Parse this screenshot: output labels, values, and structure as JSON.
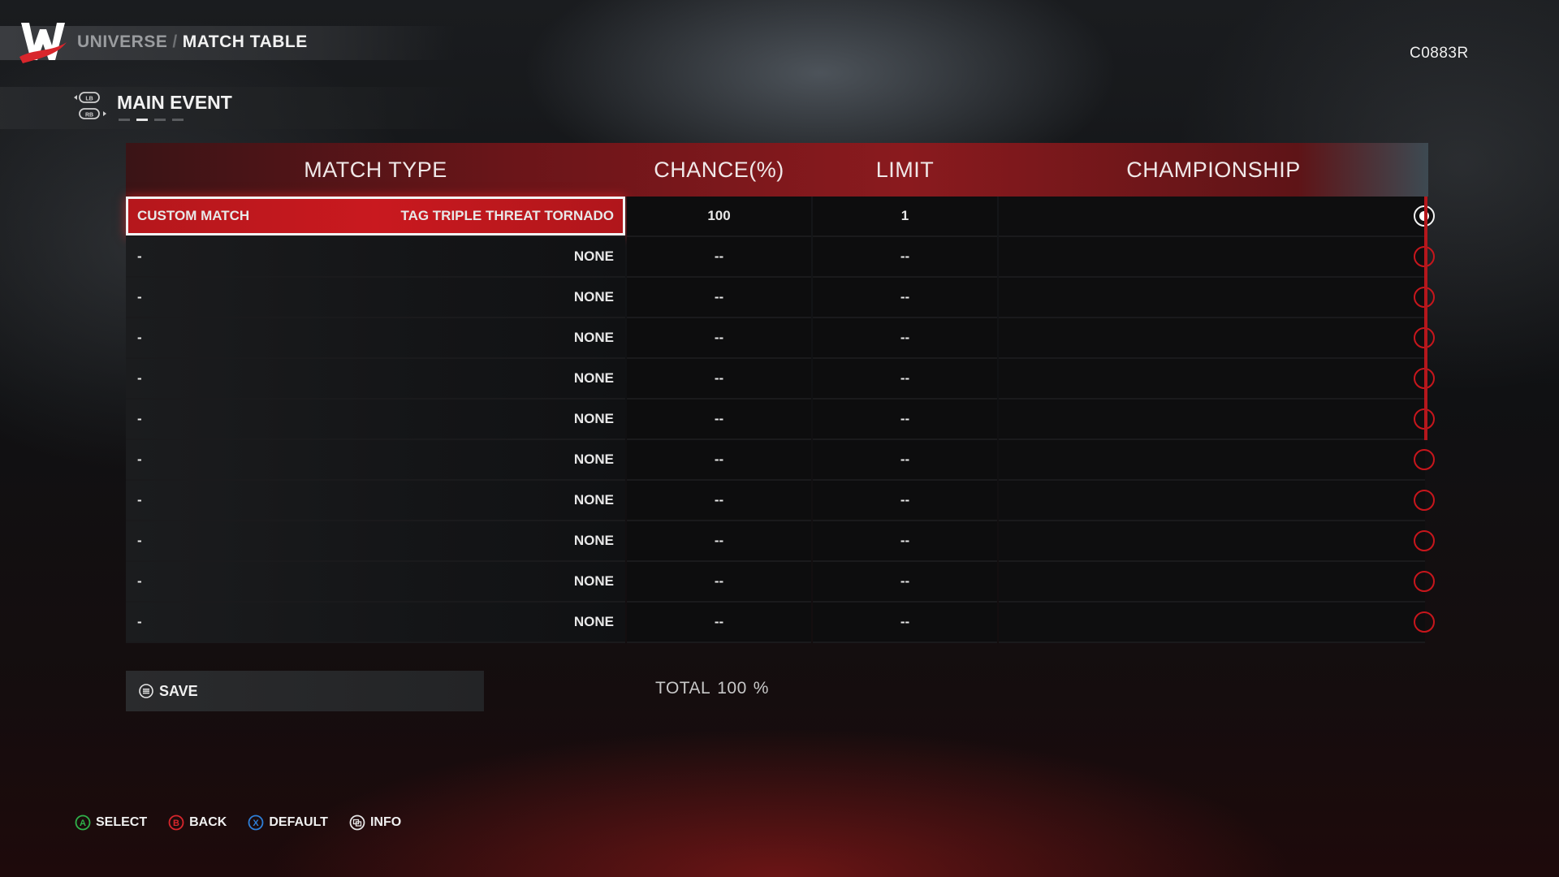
{
  "header": {
    "breadcrumb_parent": "UNIVERSE",
    "breadcrumb_separator": "/",
    "breadcrumb_current": "MATCH TABLE",
    "user_code": "C0883R"
  },
  "section": {
    "title": "MAIN EVENT",
    "page_count": 4,
    "current_page": 2,
    "prev_button": "LB",
    "next_button": "RB"
  },
  "table": {
    "columns": {
      "match_type": "MATCH TYPE",
      "chance": "CHANCE(%)",
      "limit": "LIMIT",
      "championship": "CHAMPIONSHIP"
    },
    "rows": [
      {
        "category": "CUSTOM MATCH",
        "match": "TAG TRIPLE THREAT TORNADO",
        "chance": "100",
        "limit": "1",
        "championship": true,
        "selected": true
      },
      {
        "category": "-",
        "match": "NONE",
        "chance": "--",
        "limit": "--",
        "championship": false,
        "selected": false
      },
      {
        "category": "-",
        "match": "NONE",
        "chance": "--",
        "limit": "--",
        "championship": false,
        "selected": false
      },
      {
        "category": "-",
        "match": "NONE",
        "chance": "--",
        "limit": "--",
        "championship": false,
        "selected": false
      },
      {
        "category": "-",
        "match": "NONE",
        "chance": "--",
        "limit": "--",
        "championship": false,
        "selected": false
      },
      {
        "category": "-",
        "match": "NONE",
        "chance": "--",
        "limit": "--",
        "championship": false,
        "selected": false
      },
      {
        "category": "-",
        "match": "NONE",
        "chance": "--",
        "limit": "--",
        "championship": false,
        "selected": false
      },
      {
        "category": "-",
        "match": "NONE",
        "chance": "--",
        "limit": "--",
        "championship": false,
        "selected": false
      },
      {
        "category": "-",
        "match": "NONE",
        "chance": "--",
        "limit": "--",
        "championship": false,
        "selected": false
      },
      {
        "category": "-",
        "match": "NONE",
        "chance": "--",
        "limit": "--",
        "championship": false,
        "selected": false
      },
      {
        "category": "-",
        "match": "NONE",
        "chance": "--",
        "limit": "--",
        "championship": false,
        "selected": false
      }
    ]
  },
  "footer": {
    "save_label": "SAVE",
    "total_label": "TOTAL",
    "total_value": "100",
    "total_unit": "%"
  },
  "button_hints": [
    {
      "label": "SELECT",
      "button": "A",
      "color": "#2fb24a",
      "icon": "a-button-icon"
    },
    {
      "label": "BACK",
      "button": "B",
      "color": "#d8262c",
      "icon": "b-button-icon"
    },
    {
      "label": "DEFAULT",
      "button": "X",
      "color": "#2e7fd8",
      "icon": "x-button-icon"
    },
    {
      "label": "INFO",
      "button": "",
      "color": "#e6e6e6",
      "icon": "view-button-icon"
    }
  ],
  "colors": {
    "accent_red": "#c8161c",
    "header_red": "#8a1a1e"
  }
}
